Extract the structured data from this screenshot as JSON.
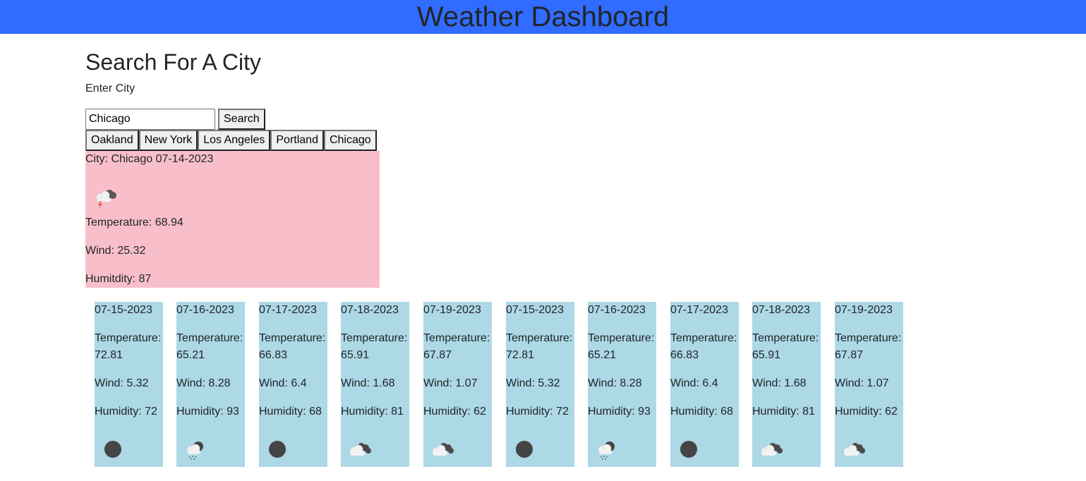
{
  "header": {
    "title": "Weather Dashboard"
  },
  "search": {
    "title": "Search For A City",
    "label": "Enter City",
    "input_value": "Chicago",
    "button_label": "Search"
  },
  "history": [
    "Oakland",
    "New York",
    "Los Angeles",
    "Portland",
    "Chicago"
  ],
  "current": {
    "city_line": "City: Chicago 07-14-2023",
    "icon": "thunderstorm-icon",
    "temperature": "Temperature: 68.94",
    "wind": "Wind: 25.32",
    "humidity": "Humitdity: 87"
  },
  "forecast": [
    {
      "date": "07-15-2023",
      "temp_label": "Temperature:",
      "temp": "72.81",
      "wind": "Wind: 5.32",
      "humidity": "Humidity: 72",
      "icon": "moon-icon"
    },
    {
      "date": "07-16-2023",
      "temp_label": "Temperature:",
      "temp": "65.21",
      "wind": "Wind: 8.28",
      "humidity": "Humidity: 93",
      "icon": "rain-night-icon"
    },
    {
      "date": "07-17-2023",
      "temp_label": "Temperature:",
      "temp": "66.83",
      "wind": "Wind: 6.4",
      "humidity": "Humidity: 68",
      "icon": "moon-icon"
    },
    {
      "date": "07-18-2023",
      "temp_label": "Temperature:",
      "temp": "65.91",
      "wind": "Wind: 1.68",
      "humidity": "Humidity: 81",
      "icon": "broken-clouds-icon"
    },
    {
      "date": "07-19-2023",
      "temp_label": "Temperature:",
      "temp": "67.87",
      "wind": "Wind: 1.07",
      "humidity": "Humidity: 62",
      "icon": "broken-clouds-icon"
    },
    {
      "date": "07-15-2023",
      "temp_label": "Temperature:",
      "temp": "72.81",
      "wind": "Wind: 5.32",
      "humidity": "Humidity: 72",
      "icon": "moon-icon"
    },
    {
      "date": "07-16-2023",
      "temp_label": "Temperature:",
      "temp": "65.21",
      "wind": "Wind: 8.28",
      "humidity": "Humidity: 93",
      "icon": "rain-night-icon"
    },
    {
      "date": "07-17-2023",
      "temp_label": "Temperature:",
      "temp": "66.83",
      "wind": "Wind: 6.4",
      "humidity": "Humidity: 68",
      "icon": "moon-icon"
    },
    {
      "date": "07-18-2023",
      "temp_label": "Temperature:",
      "temp": "65.91",
      "wind": "Wind: 1.68",
      "humidity": "Humidity: 81",
      "icon": "broken-clouds-icon"
    },
    {
      "date": "07-19-2023",
      "temp_label": "Temperature:",
      "temp": "67.87",
      "wind": "Wind: 1.07",
      "humidity": "Humidity: 62",
      "icon": "broken-clouds-icon"
    }
  ]
}
